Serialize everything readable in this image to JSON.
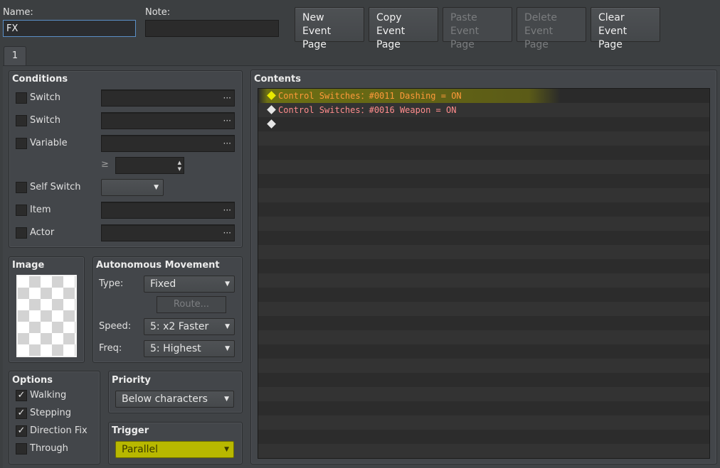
{
  "header": {
    "name_label": "Name:",
    "name_value": "FX",
    "note_label": "Note:",
    "note_value": "",
    "buttons": [
      {
        "line1": "New",
        "line2": "Event Page",
        "enabled": true
      },
      {
        "line1": "Copy",
        "line2": "Event Page",
        "enabled": true
      },
      {
        "line1": "Paste",
        "line2": "Event Page",
        "enabled": false
      },
      {
        "line1": "Delete",
        "line2": "Event Page",
        "enabled": false
      },
      {
        "line1": "Clear",
        "line2": "Event Page",
        "enabled": true
      }
    ]
  },
  "tabs": [
    {
      "label": "1"
    }
  ],
  "conditions": {
    "title": "Conditions",
    "switch1_label": "Switch",
    "switch2_label": "Switch",
    "variable_label": "Variable",
    "gte_symbol": "≥",
    "self_switch_label": "Self Switch",
    "item_label": "Item",
    "actor_label": "Actor",
    "dots": "···"
  },
  "image": {
    "title": "Image"
  },
  "autonomous": {
    "title": "Autonomous Movement",
    "type_label": "Type:",
    "type_value": "Fixed",
    "route_label": "Route...",
    "speed_label": "Speed:",
    "speed_value": "5: x2 Faster",
    "freq_label": "Freq:",
    "freq_value": "5: Highest"
  },
  "options": {
    "title": "Options",
    "walking": "Walking",
    "stepping": "Stepping",
    "direction_fix": "Direction Fix",
    "through": "Through",
    "check": "✓"
  },
  "priority": {
    "title": "Priority",
    "value": "Below characters"
  },
  "trigger": {
    "title": "Trigger",
    "value": "Parallel"
  },
  "contents": {
    "title": "Contents",
    "commands": [
      {
        "text": "Control Switches：#0011 Dashing = ON",
        "highlighted": true
      },
      {
        "text": "Control Switches：#0016 Weapon = ON",
        "highlighted": false
      },
      {
        "text": "",
        "highlighted": false
      }
    ]
  },
  "colors": {
    "bg": "#3c3f41",
    "command_text": "#ff8c8c",
    "highlight": "#b8b800",
    "focus_border": "#5b8fc7"
  },
  "icons": {
    "arrow": "▼",
    "up": "▲",
    "down": "▼"
  }
}
